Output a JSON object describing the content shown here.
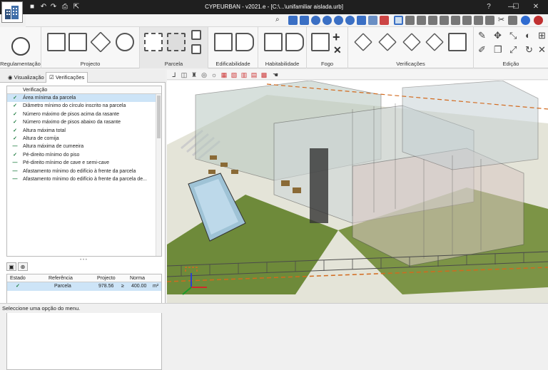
{
  "window": {
    "title": "CYPEURBAN - v2021.e - [C:\\...\\unifamiliar aislada.urb]",
    "minimize": "—",
    "maximize": "☐",
    "close": "✕"
  },
  "ribbon": {
    "groups": [
      {
        "label": "Regulamentação"
      },
      {
        "label": "Projecto"
      },
      {
        "label": "Parcela"
      },
      {
        "label": "Edificabilidade"
      },
      {
        "label": "Habitabilidade"
      },
      {
        "label": "Fogo"
      },
      {
        "label": "Verificações"
      },
      {
        "label": "Edição"
      }
    ]
  },
  "panel": {
    "tabs": [
      {
        "label": "Visualização"
      },
      {
        "label": "Verificações"
      }
    ],
    "list_header": "Verificação",
    "verifications": [
      {
        "status": "check",
        "label": "Área mínima da parcela"
      },
      {
        "status": "check",
        "label": "Diâmetro mínimo do círculo inscrito na parcela"
      },
      {
        "status": "check",
        "label": "Número máximo de pisos acima da rasante"
      },
      {
        "status": "check",
        "label": "Número máximo de pisos abaixo da rasante"
      },
      {
        "status": "check",
        "label": "Altura máxima total"
      },
      {
        "status": "check",
        "label": "Altura de cornija"
      },
      {
        "status": "dash",
        "label": "Altura máxima de cumeeira"
      },
      {
        "status": "check",
        "label": "Pé-direito mínimo do piso"
      },
      {
        "status": "dash",
        "label": "Pé-direito mínimo de cave e semi-cave"
      },
      {
        "status": "dash",
        "label": "Afastamento mínimo do edifício à frente da parcela"
      },
      {
        "status": "dash",
        "label": "Afastamento mínimo do edifício à frente da parcela de..."
      }
    ],
    "result_table": {
      "columns": [
        "Estado",
        "Referência",
        "Projecto",
        "Norma"
      ],
      "rows": [
        {
          "status": "check",
          "reference": "Parcela",
          "project": "978.56",
          "op": "≥",
          "norm": "400.00",
          "unit": "m²"
        }
      ]
    }
  },
  "status_bar": {
    "text": "Seleccione uma opção do menu."
  }
}
